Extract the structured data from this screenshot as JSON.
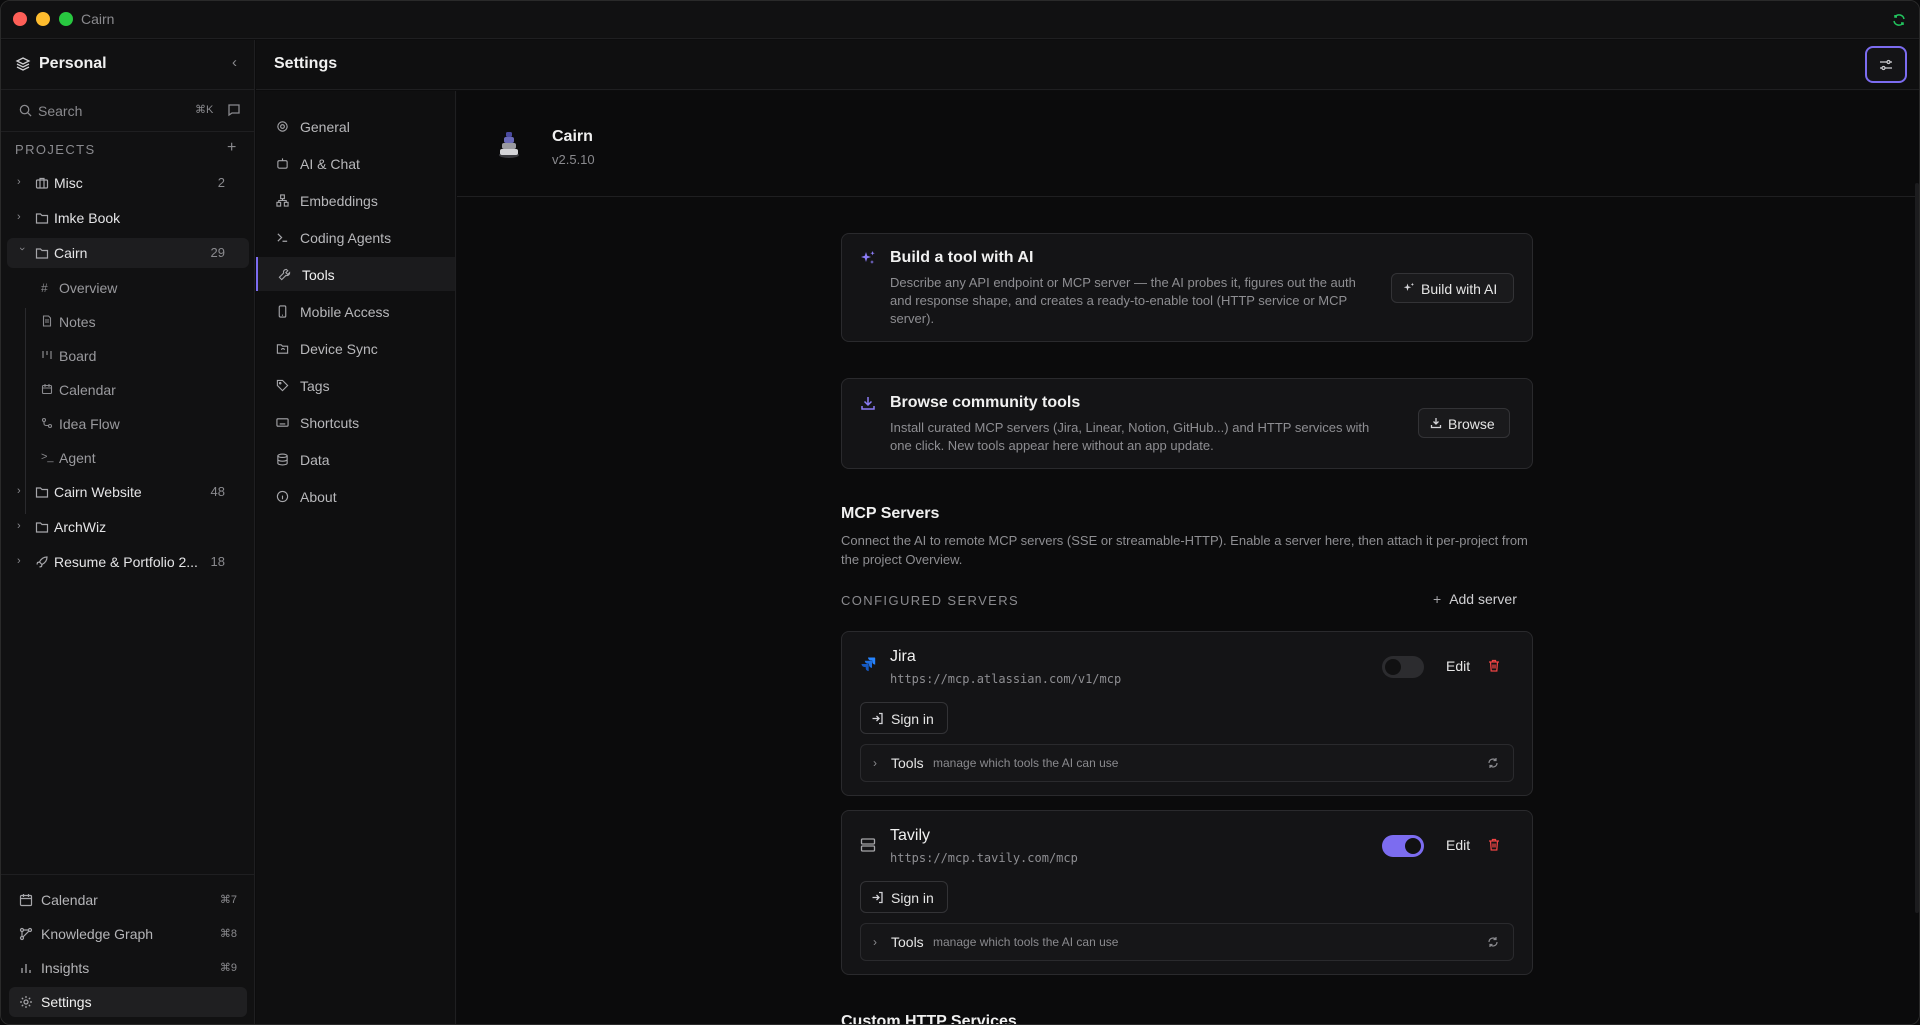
{
  "window": {
    "title": "Cairn"
  },
  "sidebar": {
    "workspace": "Personal",
    "search": {
      "placeholder": "Search",
      "shortcut": "⌘K"
    },
    "projects_heading": "PROJECTS",
    "projects": [
      {
        "label": "Misc",
        "count": "2",
        "icon": "briefcase-icon"
      },
      {
        "label": "Imke Book",
        "count": "",
        "icon": "folder-icon"
      },
      {
        "label": "Cairn",
        "count": "29",
        "icon": "folder-icon"
      },
      {
        "label": "Cairn Website",
        "count": "48",
        "icon": "folder-icon"
      },
      {
        "label": "ArchWiz",
        "count": "",
        "icon": "folder-icon"
      },
      {
        "label": "Resume & Portfolio 2...",
        "count": "18",
        "icon": "rocket-icon"
      }
    ],
    "cairn_children": [
      {
        "label": "Overview",
        "icon": "hash-icon"
      },
      {
        "label": "Notes",
        "icon": "note-icon"
      },
      {
        "label": "Board",
        "icon": "board-icon"
      },
      {
        "label": "Calendar",
        "icon": "calendar-icon"
      },
      {
        "label": "Idea Flow",
        "icon": "flow-icon"
      },
      {
        "label": "Agent",
        "icon": "terminal-icon"
      }
    ],
    "bottom_nav": [
      {
        "label": "Calendar",
        "shortcut": "⌘7"
      },
      {
        "label": "Knowledge Graph",
        "shortcut": "⌘8"
      },
      {
        "label": "Insights",
        "shortcut": "⌘9"
      },
      {
        "label": "Settings",
        "shortcut": ""
      }
    ]
  },
  "header": {
    "title": "Settings"
  },
  "settings_nav": [
    {
      "label": "General"
    },
    {
      "label": "AI & Chat"
    },
    {
      "label": "Embeddings"
    },
    {
      "label": "Coding Agents"
    },
    {
      "label": "Tools"
    },
    {
      "label": "Mobile Access"
    },
    {
      "label": "Device Sync"
    },
    {
      "label": "Tags"
    },
    {
      "label": "Shortcuts"
    },
    {
      "label": "Data"
    },
    {
      "label": "About"
    }
  ],
  "main": {
    "app_name": "Cairn",
    "app_version": "v2.5.10",
    "build_card": {
      "title": "Build a tool with AI",
      "description": "Describe any API endpoint or MCP server — the AI probes it, figures out the auth and response shape, and creates a ready-to-enable tool (HTTP service or MCP server).",
      "button": "Build with AI"
    },
    "browse_card": {
      "title": "Browse community tools",
      "description": "Install curated MCP servers (Jira, Linear, Notion, GitHub...) and HTTP services with one click. New tools appear here without an app update.",
      "button": "Browse"
    },
    "mcp": {
      "title": "MCP Servers",
      "description": "Connect the AI to remote MCP servers (SSE or streamable-HTTP). Enable a server here, then attach it per-project from the project Overview.",
      "configured_heading": "CONFIGURED SERVERS",
      "add_server": "Add server",
      "servers": [
        {
          "name": "Jira",
          "url": "https://mcp.atlassian.com/v1/mcp",
          "enabled": false,
          "edit": "Edit",
          "sign_in": "Sign in",
          "tools_label": "Tools",
          "tools_hint": "manage which tools the AI can use"
        },
        {
          "name": "Tavily",
          "url": "https://mcp.tavily.com/mcp",
          "enabled": true,
          "edit": "Edit",
          "sign_in": "Sign in",
          "tools_label": "Tools",
          "tools_hint": "manage which tools the AI can use"
        }
      ]
    },
    "custom_http_title": "Custom HTTP Services"
  },
  "colors": {
    "accent": "#7c6cf0",
    "danger": "#ef4444",
    "sync": "#22c55e",
    "jira": "#2684ff"
  }
}
